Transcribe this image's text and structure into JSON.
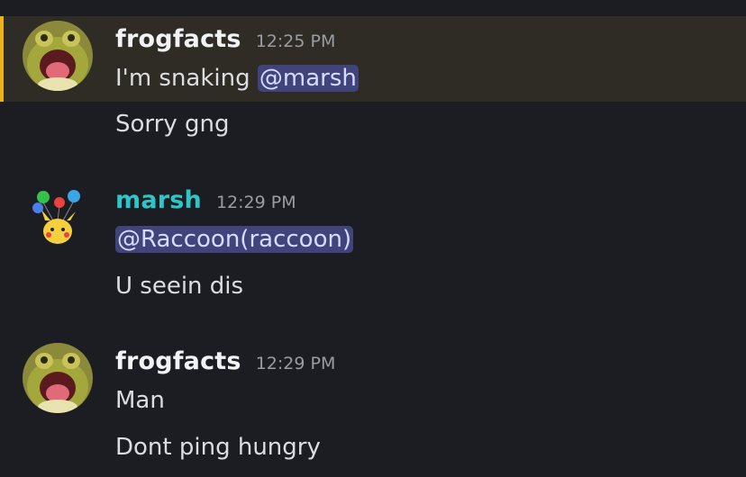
{
  "messages": [
    {
      "author": "frogfacts",
      "time": "12:25 PM",
      "line1_prefix": "I'm snaking ",
      "line1_mention": "@marsh",
      "line2": "Sorry gng"
    },
    {
      "author": "marsh",
      "time": "12:29 PM",
      "line1_mention": "@Raccoon(raccoon)",
      "line2": "U seein dis"
    },
    {
      "author": "frogfacts",
      "time": "12:29 PM",
      "line1": "Man",
      "line2": "Dont ping hungry"
    }
  ],
  "colors": {
    "background": "#1c1d22",
    "highlight_background": "#2f2c26",
    "highlight_bar": "#eab21d",
    "marsh_name": "#2ec5c9",
    "mention_bg": "#40447a"
  }
}
